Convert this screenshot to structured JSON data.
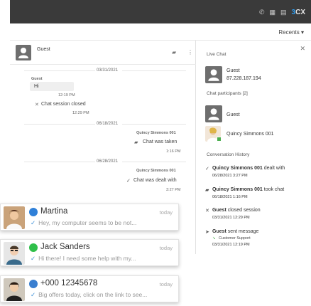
{
  "brand": {
    "prefix": "3",
    "name": "CX"
  },
  "header": {
    "recents_label": "Recents ▾"
  },
  "chat": {
    "contact_name": "Guest",
    "messages": [
      {
        "date": "03/31/2021",
        "sender": "Guest",
        "text": "Hi",
        "time": "12:19 PM"
      },
      {
        "text": "Chat session closed",
        "time": "12:29 PM"
      },
      {
        "date": "06/18/2021",
        "sender": "Quincy Simmons 001",
        "text": "Chat was taken",
        "time": "1:16 PM"
      },
      {
        "date": "06/28/2021",
        "sender": "Quincy Simmons 001",
        "text": "Chat was dealt with",
        "time": "3:27 PM"
      }
    ]
  },
  "sidebar": {
    "live_chat_title": "Live Chat",
    "guest_name": "Guest",
    "guest_ip": "87.228.187.194",
    "participants_title": "Chat participants [2]",
    "participants": [
      "Guest",
      "Quincy Simmons 001"
    ],
    "history_title": "Conversation History",
    "history": [
      {
        "actor": "Quincy Simmons 001",
        "action": " dealt with",
        "date": "06/28/2021 3:27 PM"
      },
      {
        "actor": "Quincy Simmons 001",
        "action": " took chat",
        "date": "06/18/2021 1:16 PM"
      },
      {
        "actor": "Guest",
        "action": " closed session",
        "date": "03/31/2021 12:29 PM"
      },
      {
        "actor": "Guest",
        "action": " sent message",
        "target": "Customer Support",
        "date": "03/31/2021 12:19 PM"
      }
    ]
  },
  "recents": [
    {
      "name": "Martina",
      "day": "today",
      "message": "Hey, my computer seems to be not...",
      "channel": "messenger",
      "color": "#2f80d8"
    },
    {
      "name": "Jack Sanders",
      "day": "today",
      "message": "Hi there! I need some help with my...",
      "channel": "whatsapp",
      "color": "#2fbf4a"
    },
    {
      "name": "+000 12345678",
      "day": "today",
      "message": "Big offers today, click on the link to see...",
      "channel": "sms",
      "color": "#3a7fd0"
    }
  ],
  "colors": {
    "topbar": "#3a3a3a",
    "accent": "#2c9cf0",
    "online": "#4caf50"
  }
}
